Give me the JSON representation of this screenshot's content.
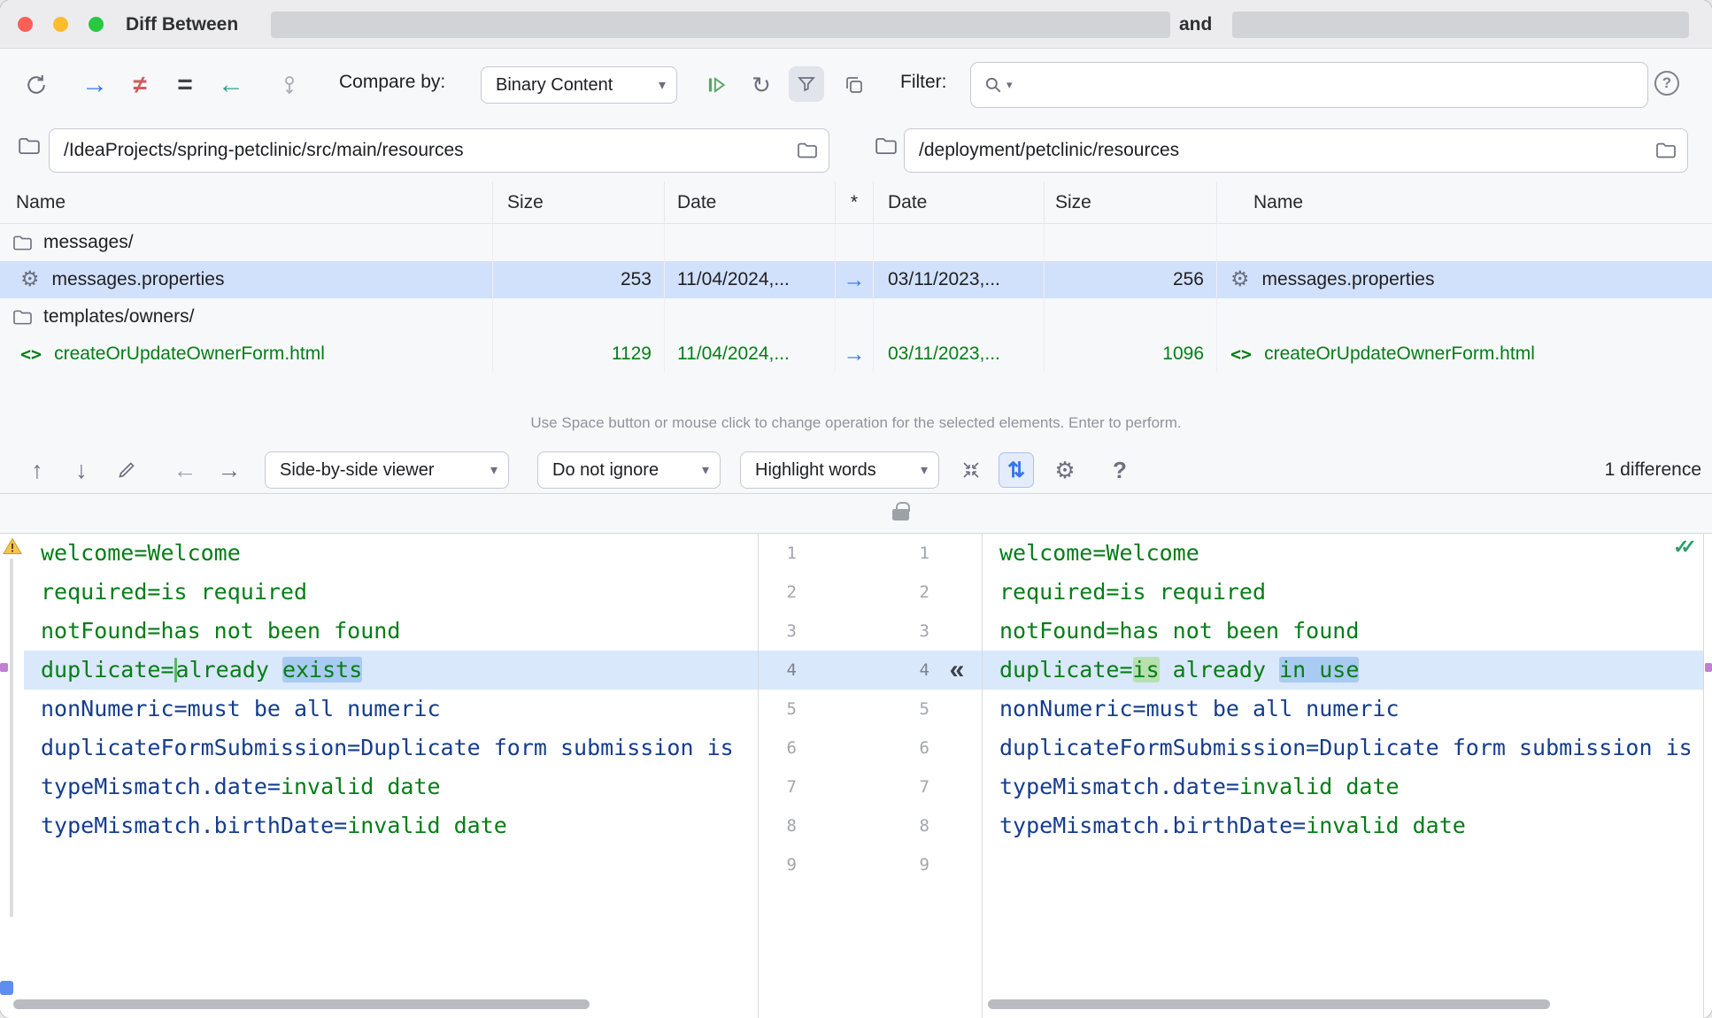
{
  "colors": {
    "accent_blue": "#3574F0",
    "properties_green": "#067D17",
    "properties_navy": "#153D8F",
    "changed_line_bg": "#DAE8FB",
    "changed_word_bg": "#A9CBF1",
    "inserted_word_bg": "#B6E1AE",
    "selected_row_bg": "#D2E1FB",
    "teal_arrow": "#2AA38C",
    "red_not_equal": "#D15A5A",
    "warning_yellow": "#F5C64A",
    "resolved_green": "#2E9D6B"
  },
  "window": {
    "title_prefix": "Diff Between",
    "title_conjunction": "and"
  },
  "toolbar": {
    "compare_by_label": "Compare by:",
    "compare_by_value": "Binary Content",
    "filter_label": "Filter:"
  },
  "paths": {
    "left": "/IdeaProjects/spring-petclinic/src/main/resources",
    "right": "/deployment/petclinic/resources"
  },
  "table": {
    "headers": [
      "Name",
      "Size",
      "Date",
      "*",
      "Date",
      "Size",
      "Name"
    ],
    "rows": [
      {
        "kind": "folder",
        "name": "messages/"
      },
      {
        "kind": "file",
        "selected": true,
        "icon": "gear",
        "color": "default",
        "name_left": "messages.properties",
        "size_left": "253",
        "date_left": "11/04/2024,...",
        "operation": "→",
        "date_right": "03/11/2023,...",
        "size_right": "256",
        "name_right": "messages.properties"
      },
      {
        "kind": "folder",
        "name": "templates/owners/"
      },
      {
        "kind": "file",
        "selected": false,
        "icon": "code",
        "color": "green",
        "name_left": "createOrUpdateOwnerForm.html",
        "size_left": "1129",
        "date_left": "11/04/2024,...",
        "operation": "→",
        "date_right": "03/11/2023,...",
        "size_right": "1096",
        "name_right": "createOrUpdateOwnerForm.html"
      }
    ]
  },
  "hint": "Use Space button or mouse click to change operation for the selected elements. Enter to perform.",
  "diff_toolbar": {
    "viewer_mode": "Side-by-side viewer",
    "ignore_mode": "Do not ignore",
    "highlight_mode": "Highlight words",
    "difference_count": "1 difference"
  },
  "icons": {
    "move_right": "→",
    "not_equal": "≠",
    "equal": "=",
    "move_left": "←",
    "rescan": "↻",
    "chevron_down": "▾",
    "search_chevron": "▾",
    "nav_up": "↑",
    "nav_down": "↓",
    "prev_diff": "←",
    "next_diff": "→",
    "sync_scroll": "⇅",
    "settings_gear": "⚙",
    "help": "?",
    "table_gear": "⚙",
    "code_tag": "<>",
    "apply_left": "«",
    "all_resolved": "✓✓"
  },
  "editor": {
    "line_numbers": [
      1,
      2,
      3,
      4,
      5,
      6,
      7,
      8,
      9
    ],
    "changed_line": 4,
    "left_lines": [
      {
        "segments": [
          {
            "t": "welcome=Welcome",
            "c": "g"
          }
        ]
      },
      {
        "segments": [
          {
            "t": "required=is required",
            "c": "g"
          }
        ]
      },
      {
        "segments": [
          {
            "t": "notFound=has not been found",
            "c": "g"
          }
        ]
      },
      {
        "changed": true,
        "segments": [
          {
            "t": "duplicate=",
            "c": "g"
          },
          {
            "caret": true
          },
          {
            "t": "already ",
            "c": "g"
          },
          {
            "t": "exists",
            "c": "g",
            "h": "chg"
          }
        ]
      },
      {
        "segments": [
          {
            "t": "nonNumeric=must be all numeric",
            "c": "n"
          }
        ]
      },
      {
        "segments": [
          {
            "t": "duplicateFormSubmission=Duplicate form submission is",
            "c": "n"
          }
        ]
      },
      {
        "segments": [
          {
            "t": "typeMismatch.date=",
            "c": "n"
          },
          {
            "t": "invalid date",
            "c": "g"
          }
        ]
      },
      {
        "segments": [
          {
            "t": "typeMismatch.birthDate=",
            "c": "n"
          },
          {
            "t": "invalid date",
            "c": "g"
          }
        ]
      }
    ],
    "right_lines": [
      {
        "segments": [
          {
            "t": "welcome=Welcome",
            "c": "g"
          }
        ]
      },
      {
        "segments": [
          {
            "t": "required=is required",
            "c": "g"
          }
        ]
      },
      {
        "segments": [
          {
            "t": "notFound=has not been found",
            "c": "g"
          }
        ]
      },
      {
        "changed": true,
        "segments": [
          {
            "t": "duplicate=",
            "c": "g"
          },
          {
            "t": "is",
            "c": "g",
            "h": "ins"
          },
          {
            "t": " already ",
            "c": "g"
          },
          {
            "t": "in use",
            "c": "g",
            "h": "chg"
          }
        ]
      },
      {
        "segments": [
          {
            "t": "nonNumeric=must be all numeric",
            "c": "n"
          }
        ]
      },
      {
        "segments": [
          {
            "t": "duplicateFormSubmission=Duplicate form submission is",
            "c": "n"
          }
        ]
      },
      {
        "segments": [
          {
            "t": "typeMismatch.date=",
            "c": "n"
          },
          {
            "t": "invalid date",
            "c": "g"
          }
        ]
      },
      {
        "segments": [
          {
            "t": "typeMismatch.birthDate=",
            "c": "n"
          },
          {
            "t": "invalid date",
            "c": "g"
          }
        ]
      }
    ]
  }
}
